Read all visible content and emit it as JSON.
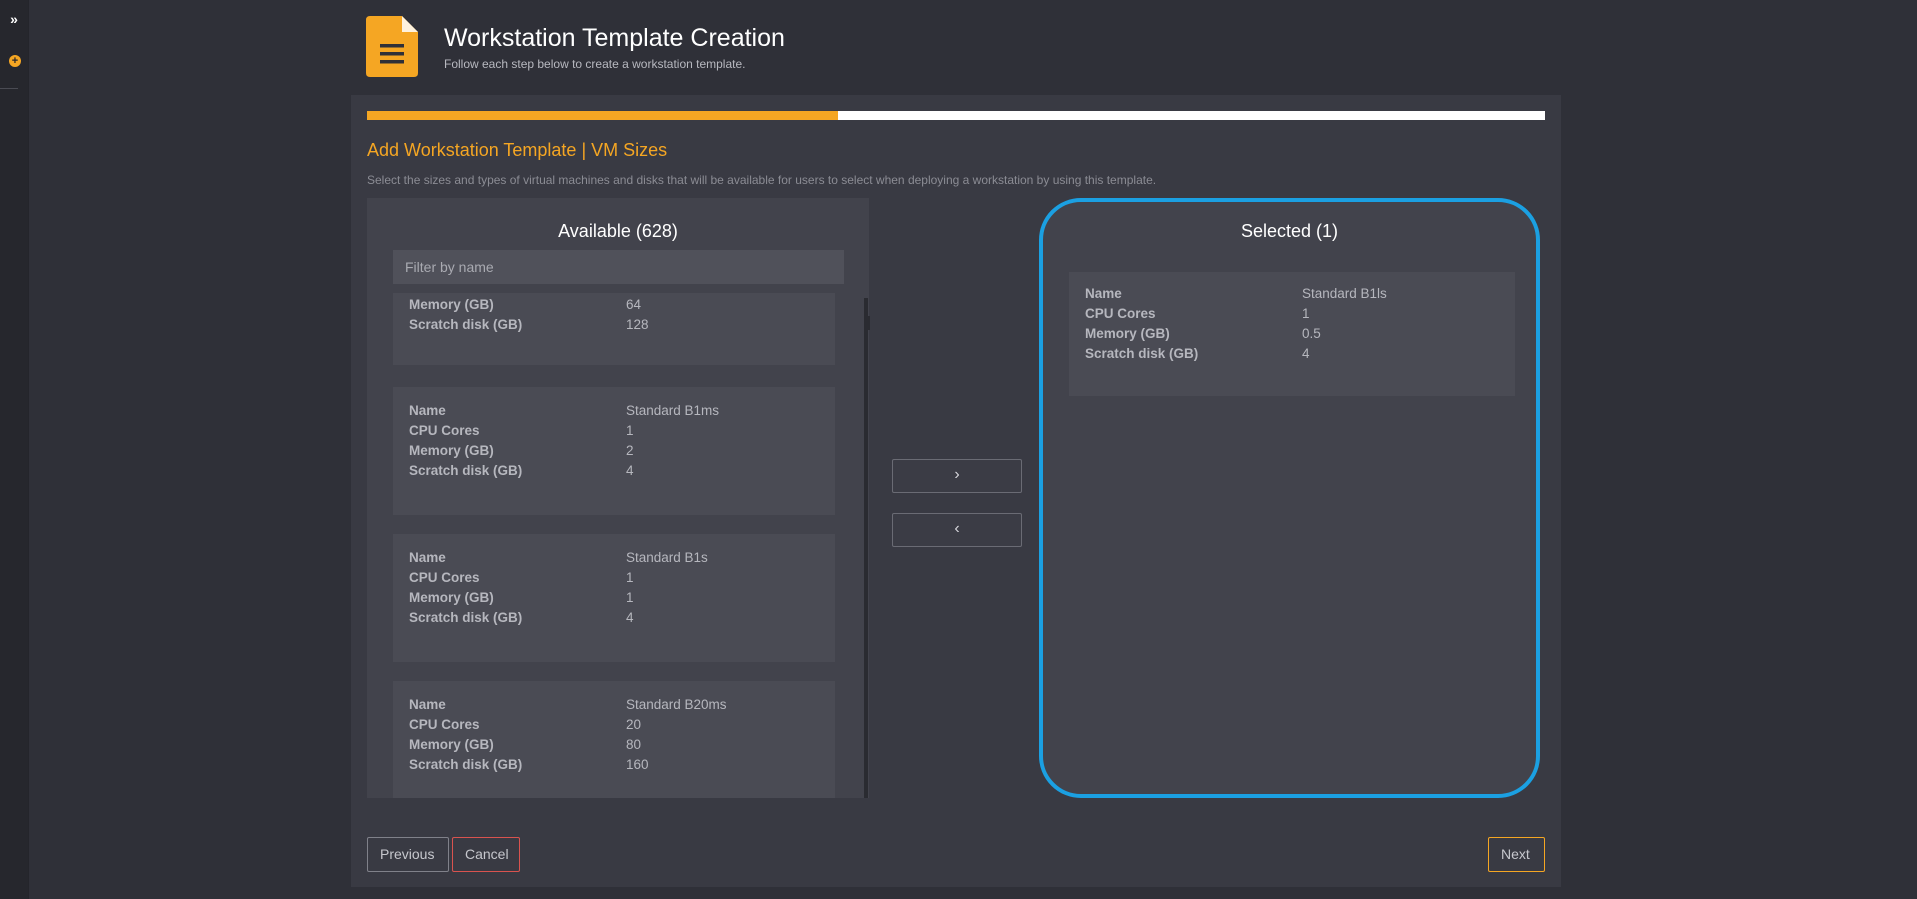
{
  "header": {
    "title": "Workstation Template Creation",
    "subtitle": "Follow each step below to create a workstation template.",
    "icon": "document-icon"
  },
  "progress": {
    "value": 0.4,
    "accent": "#f5a623"
  },
  "step": {
    "title": "Add Workstation Template | VM Sizes",
    "description": "Select the sizes and types of virtual machines and disks that will be available for users to select when deploying a workstation by using this template."
  },
  "available": {
    "title": "Available (628)",
    "filter_placeholder": "Filter by name",
    "items": [
      {
        "rows": [
          {
            "key": "Memory (GB)",
            "value": "64"
          },
          {
            "key": "Scratch disk (GB)",
            "value": "128"
          }
        ]
      },
      {
        "rows": [
          {
            "key": "Name",
            "value": "Standard B1ms"
          },
          {
            "key": "CPU Cores",
            "value": "1"
          },
          {
            "key": "Memory (GB)",
            "value": "2"
          },
          {
            "key": "Scratch disk (GB)",
            "value": "4"
          }
        ]
      },
      {
        "rows": [
          {
            "key": "Name",
            "value": "Standard B1s"
          },
          {
            "key": "CPU Cores",
            "value": "1"
          },
          {
            "key": "Memory (GB)",
            "value": "1"
          },
          {
            "key": "Scratch disk (GB)",
            "value": "4"
          }
        ]
      },
      {
        "rows": [
          {
            "key": "Name",
            "value": "Standard B20ms"
          },
          {
            "key": "CPU Cores",
            "value": "20"
          },
          {
            "key": "Memory (GB)",
            "value": "80"
          },
          {
            "key": "Scratch disk (GB)",
            "value": "160"
          }
        ]
      }
    ]
  },
  "transfer": {
    "add_label": "›",
    "remove_label": "‹"
  },
  "selected": {
    "title": "Selected (1)",
    "highlight_color": "#1ba0e2",
    "items": [
      {
        "rows": [
          {
            "key": "Name",
            "value": "Standard B1ls"
          },
          {
            "key": "CPU Cores",
            "value": "1"
          },
          {
            "key": "Memory (GB)",
            "value": "0.5"
          },
          {
            "key": "Scratch disk (GB)",
            "value": "4"
          }
        ]
      }
    ]
  },
  "footer": {
    "previous": "Previous",
    "cancel": "Cancel",
    "next": "Next"
  }
}
